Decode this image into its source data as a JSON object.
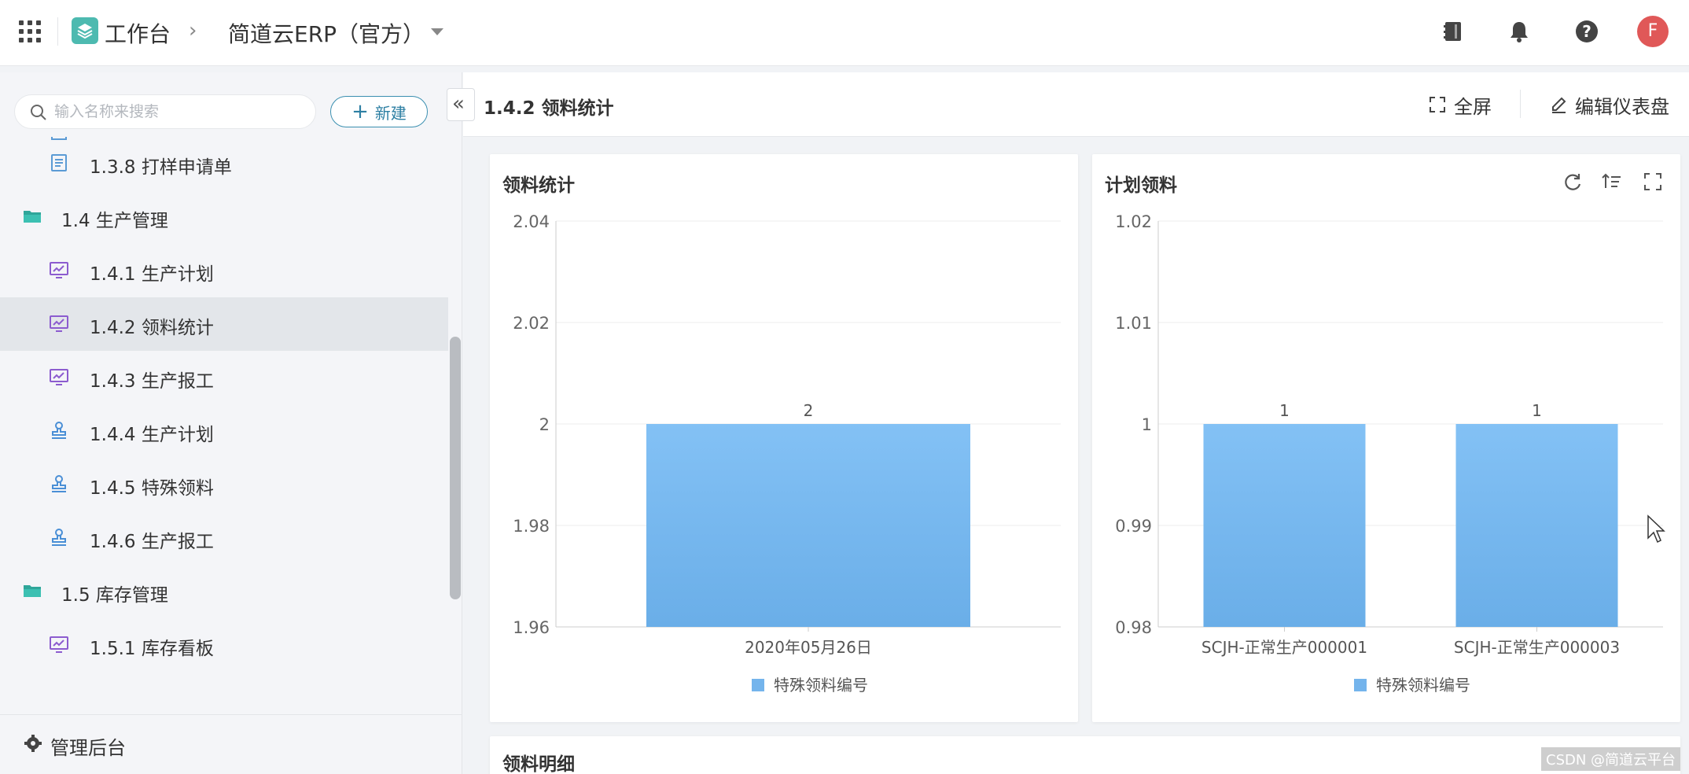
{
  "topbar": {
    "workbench": "工作台",
    "app_name": "简道云ERP（官方）",
    "avatar_letter": "F"
  },
  "sidebar": {
    "search_placeholder": "输入名称来搜索",
    "new_label": "新建",
    "items": [
      {
        "label": "1.3.8 打样申请单",
        "type": "leaf",
        "icon": "form-icon"
      },
      {
        "label": "1.4 生产管理",
        "type": "folder",
        "icon": "folder-icon"
      },
      {
        "label": "1.4.1 生产计划",
        "type": "leaf",
        "icon": "dashboard-icon"
      },
      {
        "label": "1.4.2 领料统计",
        "type": "leaf",
        "icon": "dashboard-icon",
        "active": true
      },
      {
        "label": "1.4.3 生产报工",
        "type": "leaf",
        "icon": "dashboard-icon"
      },
      {
        "label": "1.4.4 生产计划",
        "type": "leaf",
        "icon": "stamp-icon"
      },
      {
        "label": "1.4.5 特殊领料",
        "type": "leaf",
        "icon": "stamp-icon"
      },
      {
        "label": "1.4.6 生产报工",
        "type": "leaf",
        "icon": "stamp-icon"
      },
      {
        "label": "1.5 库存管理",
        "type": "folder",
        "icon": "folder-icon"
      },
      {
        "label": "1.5.1 库存看板",
        "type": "leaf",
        "icon": "dashboard-icon"
      }
    ],
    "admin_label": "管理后台"
  },
  "header": {
    "title": "1.4.2 领料统计",
    "fullscreen_label": "全屏",
    "edit_label": "编辑仪表盘"
  },
  "cards": {
    "left_title": "领料统计",
    "right_title": "计划领料",
    "bottom_title": "领料明细"
  },
  "chart_data": [
    {
      "type": "bar",
      "title": "领料统计",
      "categories": [
        "2020年05月26日"
      ],
      "series": [
        {
          "name": "特殊领料编号",
          "values": [
            2
          ]
        }
      ],
      "ylim": [
        1.96,
        2.04
      ],
      "yticks": [
        "2.04",
        "2.02",
        "2",
        "1.98",
        "1.96"
      ],
      "data_labels": [
        "2"
      ],
      "grid": true,
      "legend": "bottom",
      "color": "#74b4ec"
    },
    {
      "type": "bar",
      "title": "计划领料",
      "categories": [
        "SCJH-正常生产000001",
        "SCJH-正常生产000003"
      ],
      "series": [
        {
          "name": "特殊领料编号",
          "values": [
            1,
            1
          ]
        }
      ],
      "ylim": [
        0.98,
        1.02
      ],
      "yticks": [
        "1.02",
        "1.01",
        "1",
        "0.99",
        "0.98"
      ],
      "data_labels": [
        "1",
        "1"
      ],
      "grid": true,
      "legend": "bottom",
      "color": "#74b4ec"
    }
  ],
  "watermark": "CSDN @简道云平台"
}
